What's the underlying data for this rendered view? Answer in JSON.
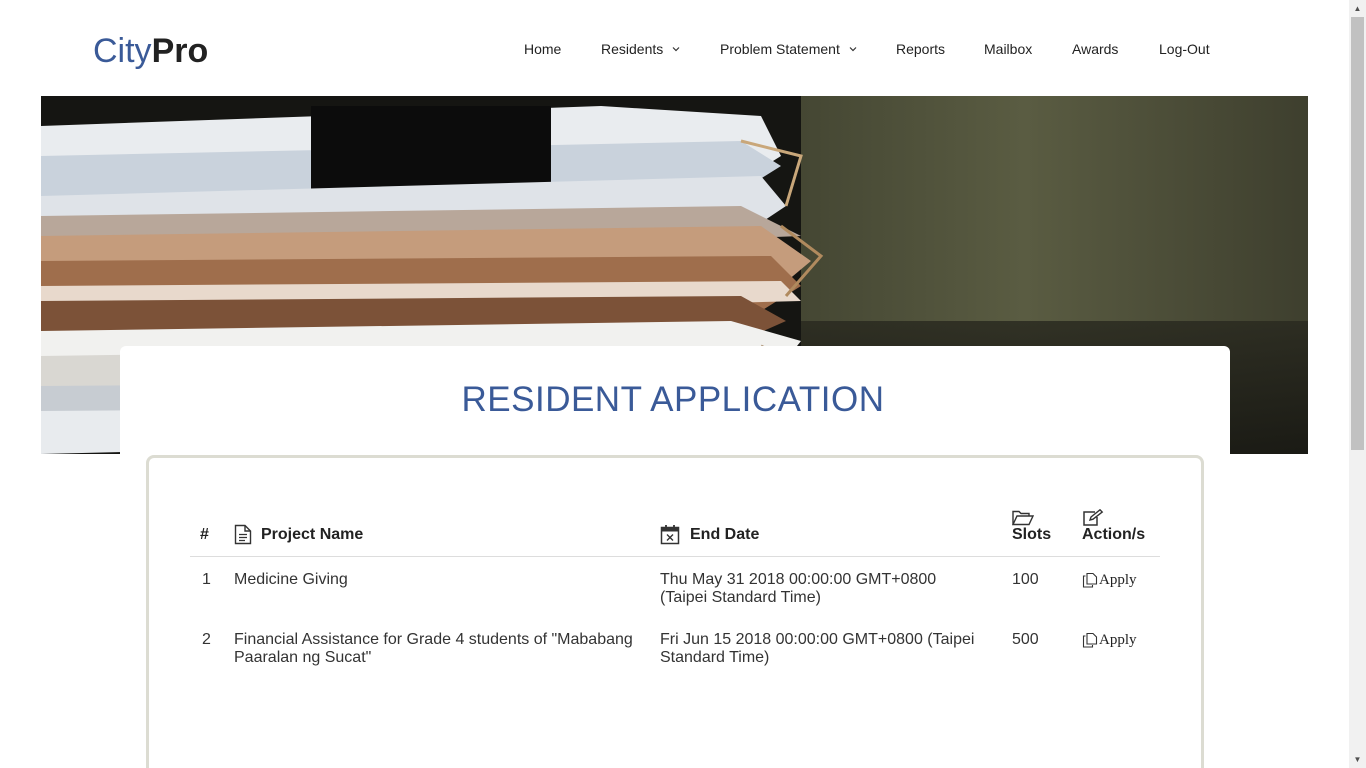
{
  "brand": {
    "city": "City",
    "pro": "Pro"
  },
  "nav": {
    "items": [
      {
        "label": "Home"
      },
      {
        "label": "Residents",
        "dropdown": true
      },
      {
        "label": "Problem Statement",
        "dropdown": true
      },
      {
        "label": "Reports"
      },
      {
        "label": "Mailbox"
      },
      {
        "label": "Awards"
      },
      {
        "label": "Log-Out"
      }
    ]
  },
  "page": {
    "title": "RESIDENT APPLICATION"
  },
  "table": {
    "headers": {
      "num": "#",
      "project": "Project Name",
      "end_date": "End Date",
      "slots": "Slots",
      "action": "Action/s"
    },
    "rows": [
      {
        "num": "1",
        "project_line1": "Medicine Giving",
        "project_line2": "",
        "end_line1": "Thu May 31 2018 00:00:00 GMT+0800",
        "end_line2": "(Taipei Standard Time)",
        "slots": "100",
        "action": "Apply"
      },
      {
        "num": "2",
        "project_line1": "Financial Assistance for Grade 4 students of \"Mababang",
        "project_line2": "Paaralan ng Sucat\"",
        "end_line1": "Fri Jun 15 2018 00:00:00 GMT+0800 (Taipei",
        "end_line2": "Standard Time)",
        "slots": "500",
        "action": "Apply"
      }
    ]
  },
  "colors": {
    "brand_blue": "#3a5a98",
    "panel_border": "#dcdcd2"
  },
  "icons": {
    "project": "document-icon",
    "end_date": "calendar-x-icon",
    "slots": "folder-open-icon",
    "action": "edit-icon",
    "apply": "copy-icon"
  }
}
